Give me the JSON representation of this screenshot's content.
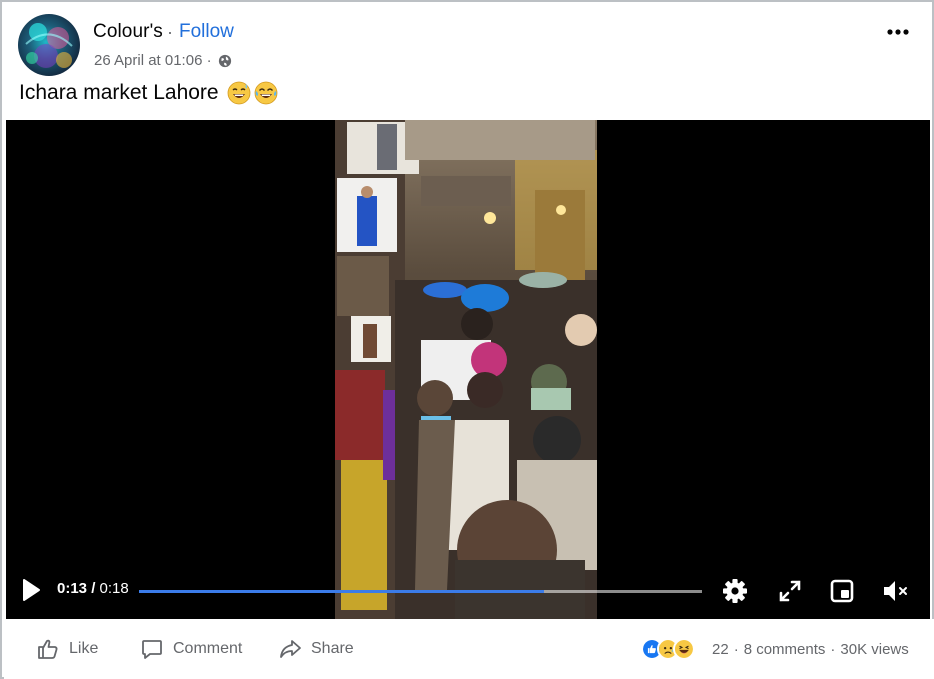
{
  "post": {
    "author": "Colour's",
    "separator": "·",
    "follow_label": "Follow",
    "timestamp": "26 April at 01:06 ·",
    "privacy_icon": "globe-icon",
    "more_icon": "more-horizontal-icon",
    "caption": "Ichara market Lahore",
    "caption_emojis": [
      "grinning-sweat-emoji",
      "tears-of-joy-emoji"
    ]
  },
  "video": {
    "current_time": "0:13",
    "separator": " / ",
    "total_time": "0:18",
    "progress": 0.72,
    "controls": [
      "play-icon",
      "settings-icon",
      "fullscreen-icon",
      "picture-in-picture-icon",
      "mute-icon"
    ],
    "progress_color": "#3b7ce9"
  },
  "footer": {
    "like_label": "Like",
    "comment_label": "Comment",
    "share_label": "Share",
    "reactions": [
      "like-reaction",
      "sad-reaction",
      "haha-reaction"
    ],
    "reaction_count": "22",
    "dot": "·",
    "comments": "8 comments",
    "views": "30K views"
  },
  "colors": {
    "link_blue": "#216fdb",
    "secondary_text": "#65676b",
    "primary_text": "#050505"
  }
}
